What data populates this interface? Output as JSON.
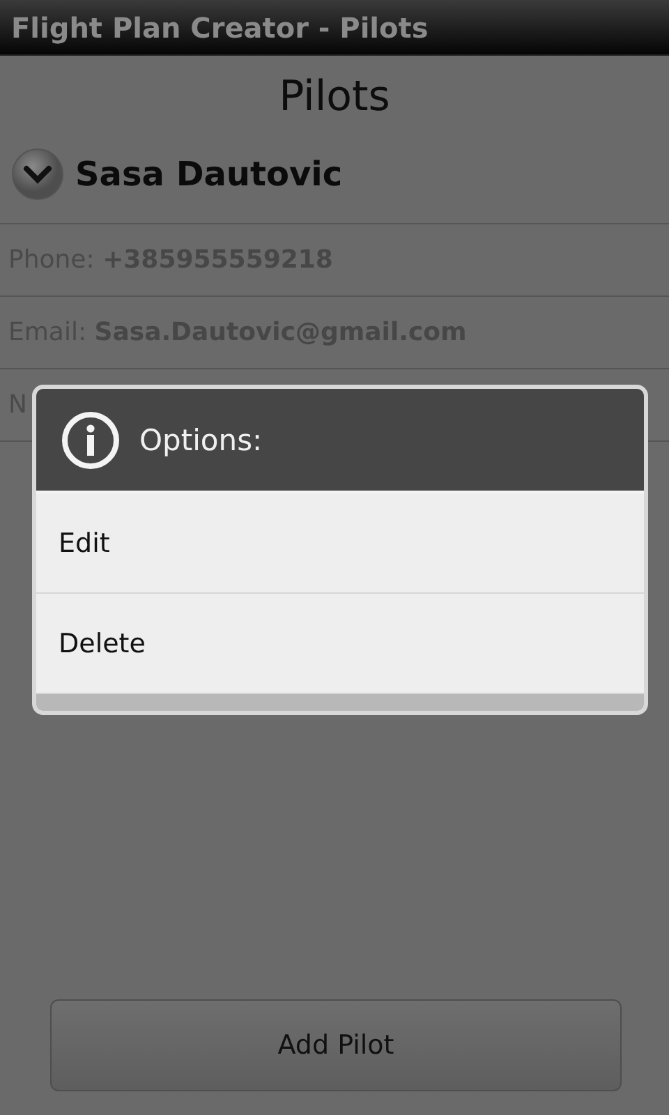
{
  "window": {
    "title": "Flight Plan Creator - Pilots"
  },
  "heading": "Pilots",
  "pilot": {
    "name": "Sasa Dautovic",
    "expanded": true,
    "details": [
      {
        "label": "Phone:",
        "value": "+385955559218"
      },
      {
        "label": "Email:",
        "value": "Sasa.Dautovic@gmail.com"
      },
      {
        "label": "N"
      }
    ]
  },
  "dialog": {
    "title": "Options:",
    "items": [
      "Edit",
      "Delete"
    ]
  },
  "buttons": [
    "Add Pilot"
  ]
}
